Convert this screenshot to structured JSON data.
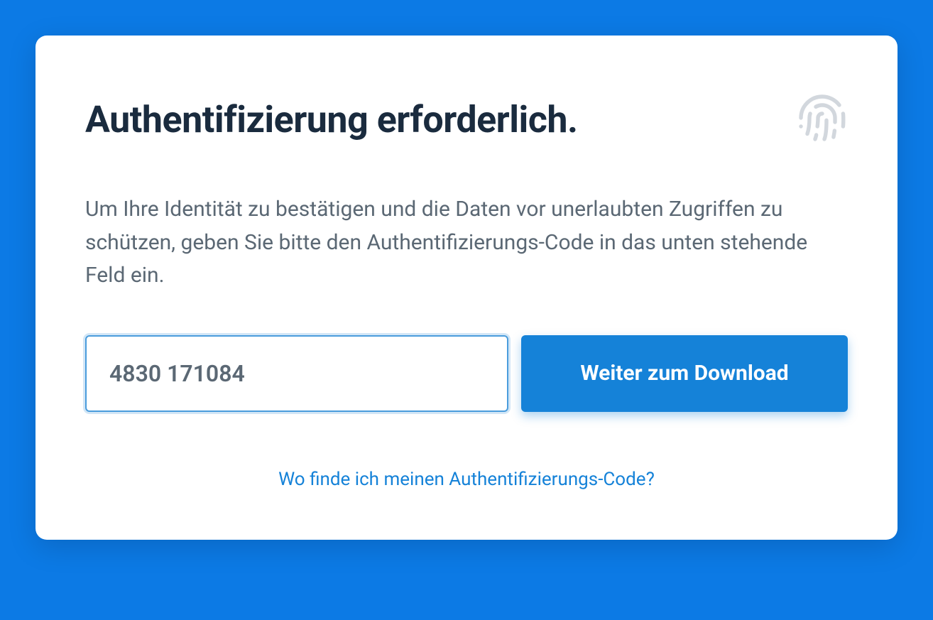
{
  "card": {
    "title": "Authentifizierung erforderlich.",
    "description": "Um Ihre Identität zu bestätigen und die Daten vor unerlaubten Zugriffen zu schützen, geben Sie bitte den Authentifizierungs-Code in das unten stehende Feld ein.",
    "input_value": "4830 171084",
    "input_placeholder": "",
    "button_label": "Weiter zum Download",
    "help_link_label": "Wo finde ich meinen Authentifizierungs-Code?"
  },
  "colors": {
    "background": "#0c7ae5",
    "card_bg": "#ffffff",
    "title_color": "#1a2b3e",
    "text_color": "#5b6874",
    "accent": "#1582d8",
    "input_border": "#4a9cdc",
    "icon_color": "#d2d7dd"
  }
}
